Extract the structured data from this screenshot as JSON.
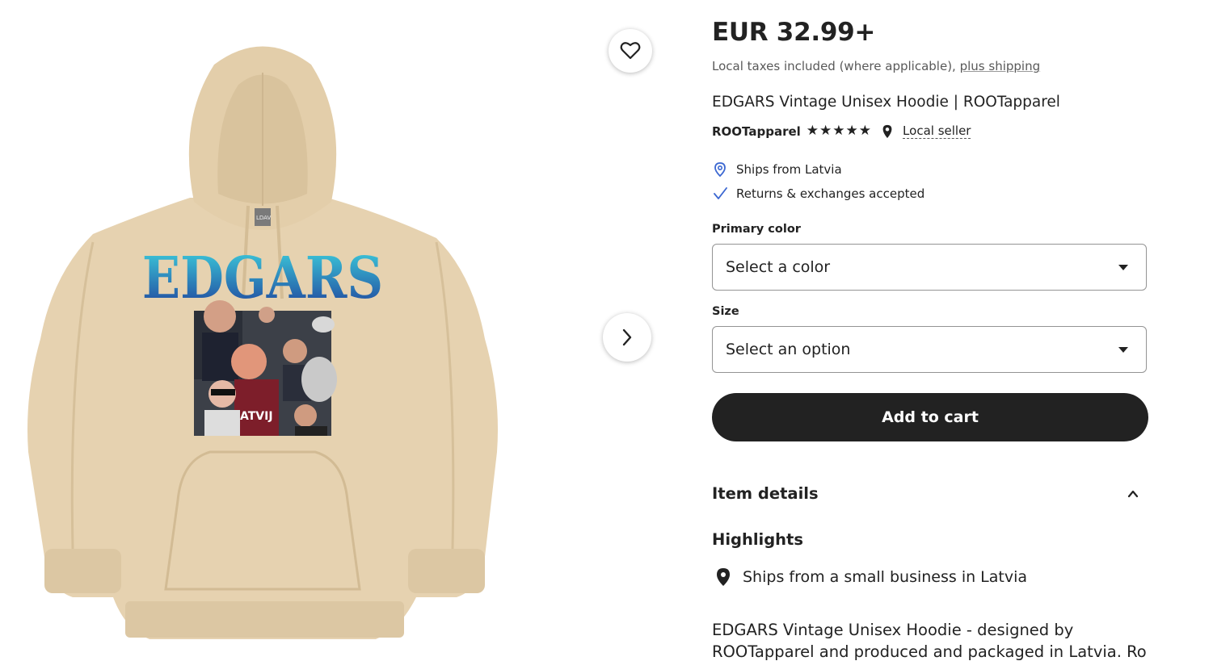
{
  "colors": {
    "text": "#222222",
    "muted": "#595959",
    "button": "#222222",
    "accent_blue": "#3b67d1",
    "hoodie": "#e6d2b0"
  },
  "gallery": {
    "print_title": "EDGARS",
    "tag_text": "LDAV",
    "favorite_icon": "heart-icon",
    "next_icon": "chevron-right-icon"
  },
  "listing": {
    "price": "EUR 32.99+",
    "tax_prefix": "Local taxes included (where applicable),",
    "shipping_link": "plus shipping",
    "title": "EDGARS Vintage Unisex Hoodie | ROOTapparel",
    "shop_name": "ROOTapparel",
    "rating_stars": 5,
    "local_seller": "Local seller",
    "perks": [
      {
        "icon": "location-pin-icon",
        "text": "Ships from Latvia"
      },
      {
        "icon": "checkmark-icon",
        "text": "Returns & exchanges accepted"
      }
    ]
  },
  "options": {
    "color_label": "Primary color",
    "color_value": "Select a color",
    "size_label": "Size",
    "size_value": "Select an option"
  },
  "cart": {
    "label": "Add to cart"
  },
  "details": {
    "header": "Item details",
    "highlights_label": "Highlights",
    "highlight_item": "Ships from a small business in Latvia",
    "description_line1": "EDGARS Vintage Unisex Hoodie - designed by",
    "description_line2": "ROOTapparel and produced and packaged in Latvia. Ro"
  }
}
